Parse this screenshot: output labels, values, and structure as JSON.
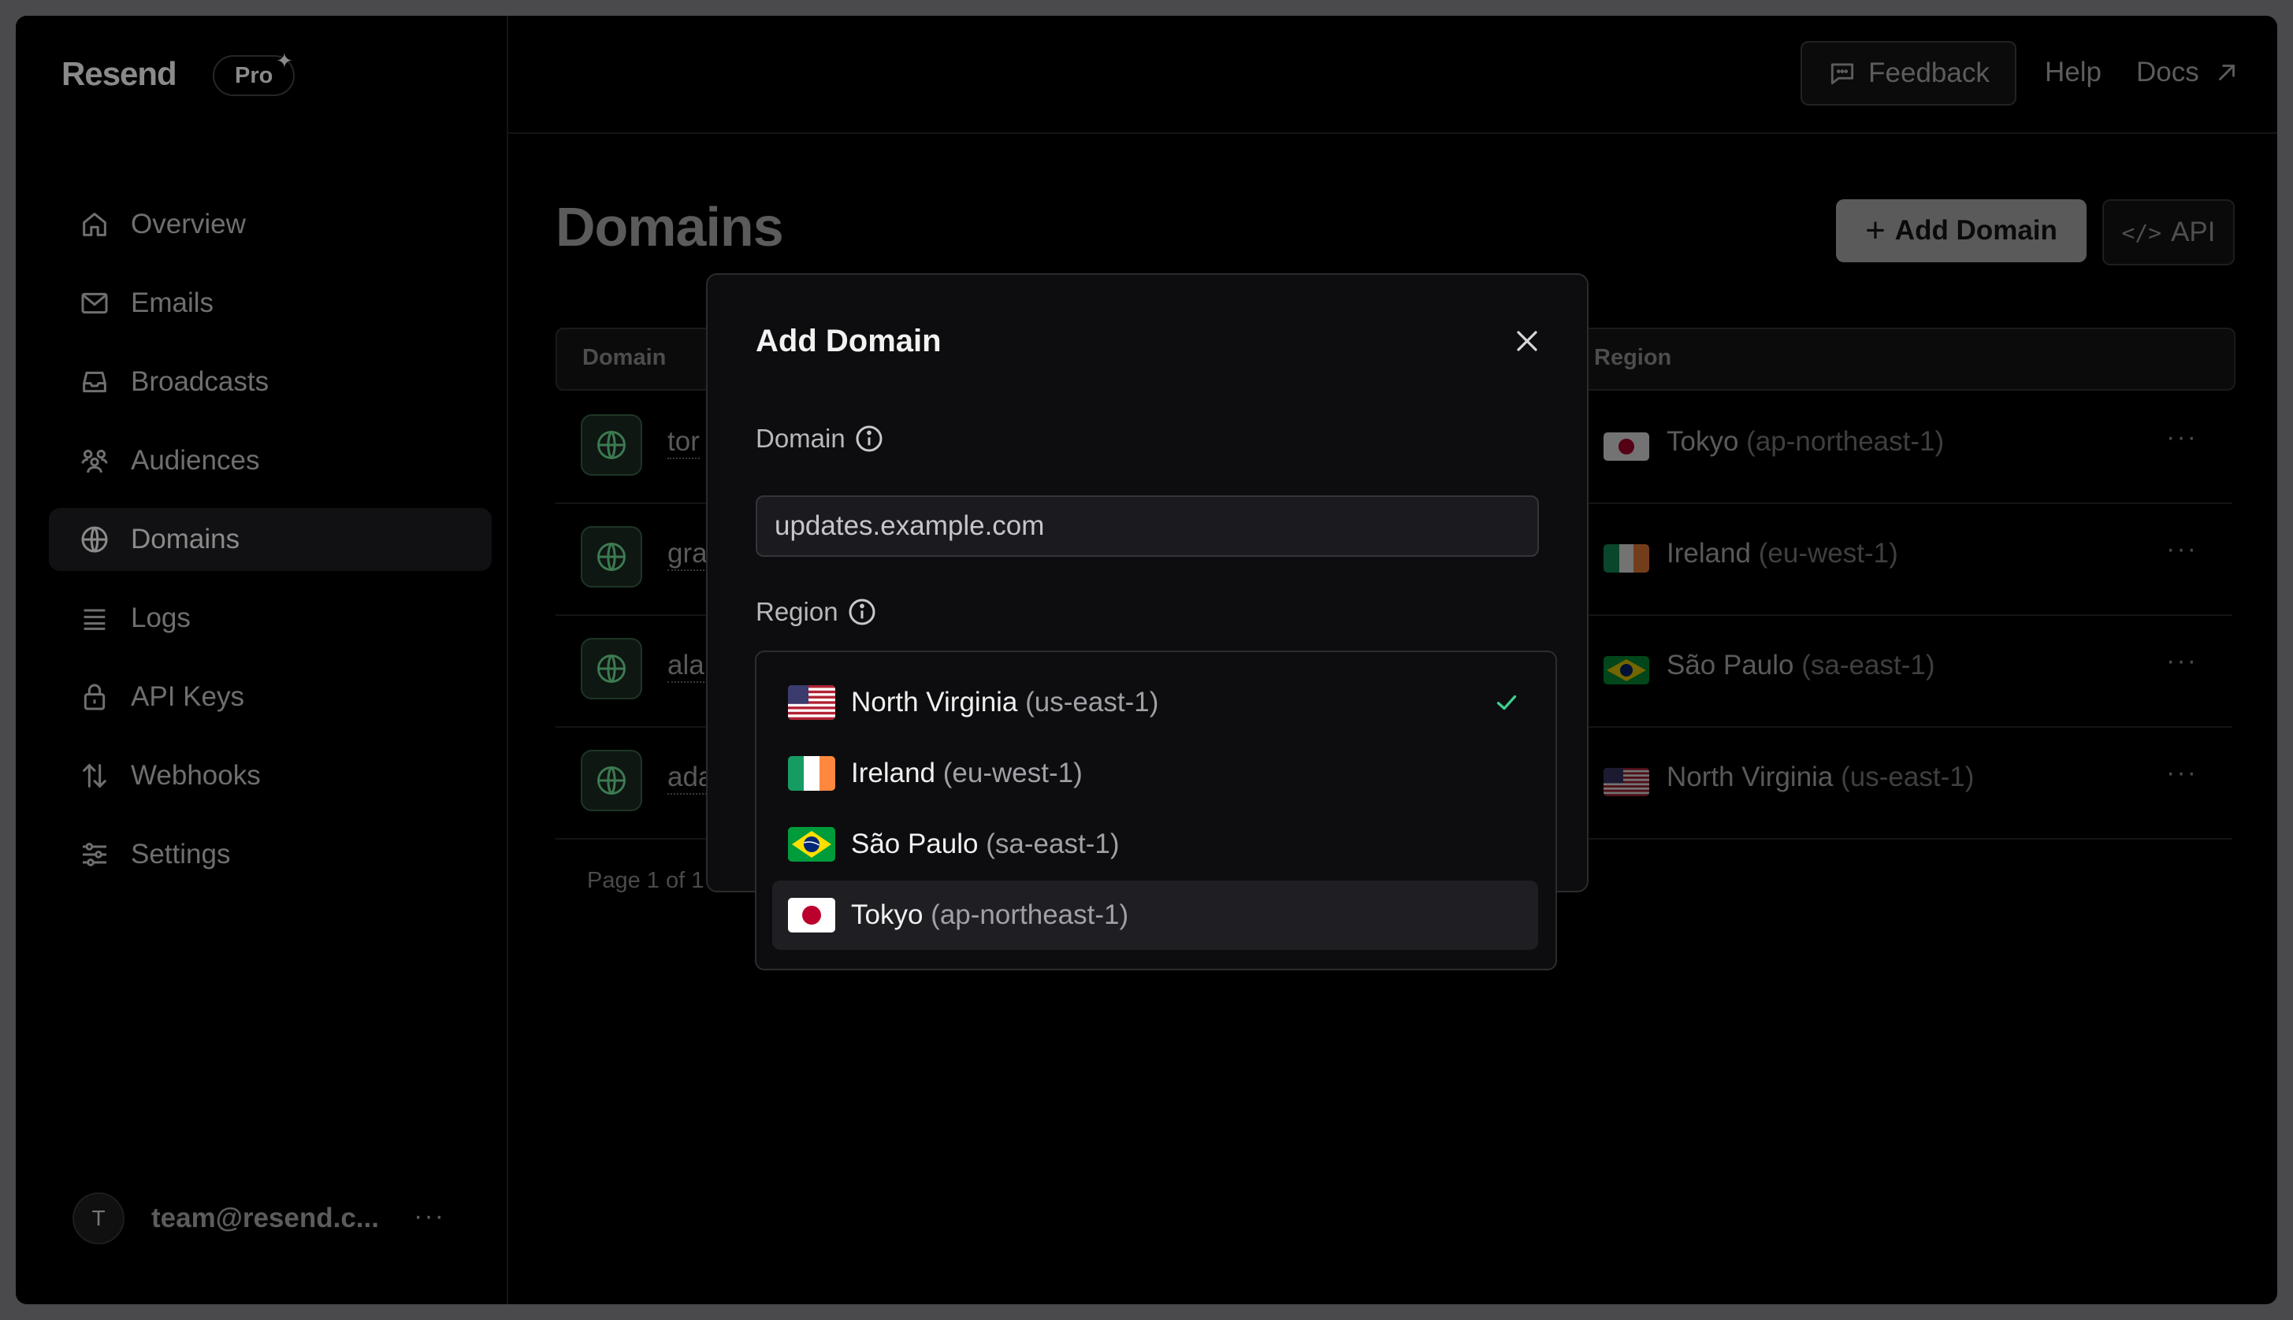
{
  "app": {
    "logo": "Resend",
    "plan_badge": "Pro"
  },
  "sidebar": {
    "items": [
      {
        "label": "Overview",
        "icon": "home-icon"
      },
      {
        "label": "Emails",
        "icon": "mail-icon"
      },
      {
        "label": "Broadcasts",
        "icon": "inbox-icon"
      },
      {
        "label": "Audiences",
        "icon": "users-icon"
      },
      {
        "label": "Domains",
        "icon": "globe-icon",
        "active": true
      },
      {
        "label": "Logs",
        "icon": "list-icon"
      },
      {
        "label": "API Keys",
        "icon": "lock-icon"
      },
      {
        "label": "Webhooks",
        "icon": "arrows-icon"
      },
      {
        "label": "Settings",
        "icon": "sliders-icon"
      }
    ],
    "user": {
      "initial": "T",
      "email": "team@resend.c...",
      "more": "···"
    }
  },
  "topbar": {
    "feedback": "Feedback",
    "help": "Help",
    "docs": "Docs"
  },
  "main": {
    "title": "Domains",
    "add_domain_label": "Add Domain",
    "api_label": "API",
    "table": {
      "headers": {
        "domain": "Domain",
        "region": "Region"
      },
      "rows": [
        {
          "name": "tor",
          "region": "Tokyo",
          "code": "(ap-northeast-1)",
          "flag": "jp"
        },
        {
          "name": "gra",
          "region": "Ireland",
          "code": "(eu-west-1)",
          "flag": "ie"
        },
        {
          "name": "ala",
          "region": "São Paulo",
          "code": "(sa-east-1)",
          "flag": "br"
        },
        {
          "name": "ada",
          "region": "North Virginia",
          "code": "(us-east-1)",
          "flag": "us"
        }
      ],
      "row_more": "···"
    },
    "pagination": "Page 1 of 1"
  },
  "modal": {
    "title": "Add Domain",
    "domain_label": "Domain",
    "domain_value": "updates.example.com",
    "region_label": "Region",
    "region_options": [
      {
        "name": "North Virginia",
        "code": "(us-east-1)",
        "flag": "us",
        "selected": true
      },
      {
        "name": "Ireland",
        "code": "(eu-west-1)",
        "flag": "ie"
      },
      {
        "name": "São Paulo",
        "code": "(sa-east-1)",
        "flag": "br"
      },
      {
        "name": "Tokyo",
        "code": "(ap-northeast-1)",
        "flag": "jp",
        "highlighted": true
      }
    ]
  },
  "colors": {
    "background": "#000000",
    "modal": "#0d0d0f",
    "accent_check": "#3ecf8e",
    "globe_green": "#2f6b45"
  }
}
